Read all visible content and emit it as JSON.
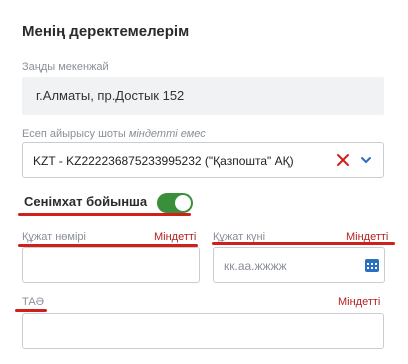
{
  "section_title": "Менің деректемелерім",
  "legal_address": {
    "label": "Заңды мекенжай",
    "value": "г.Алматы, пр.Достык 152"
  },
  "account": {
    "label": "Есеп айырысу шоты",
    "optional_note": "міндетті емес",
    "value": "KZT - KZ222236875233995232 (\"Қазпошта\" АҚ)",
    "clear_icon": "close-icon",
    "dropdown_icon": "chevron-down-icon"
  },
  "power_of_attorney": {
    "label": "Сенімхат бойынша",
    "toggle_on": true
  },
  "doc_number": {
    "label": "Құжат нөмірі",
    "required": "Міндетті",
    "value": ""
  },
  "doc_date": {
    "label": "Құжат күні",
    "required": "Міндетті",
    "placeholder": "кк.аа.жжжж",
    "icon": "calendar-icon"
  },
  "fio": {
    "label": "ТАӘ",
    "required": "Міндетті",
    "value": ""
  },
  "colors": {
    "accent_green": "#3a8f3a",
    "required_red": "#b52020",
    "annotation_red": "#d0201a",
    "icon_blue": "#2a6fc0"
  }
}
